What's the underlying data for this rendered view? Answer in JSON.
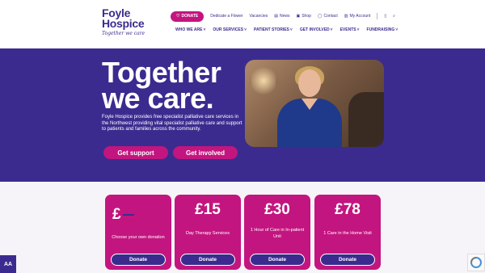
{
  "logo": {
    "line1": "Foyle",
    "line2": "Hospice",
    "tagline": "Together we care"
  },
  "topbar": {
    "donate": "DONATE",
    "links": [
      "Dedicate a Flower",
      "Vacancies",
      "News",
      "Shop",
      "Contact",
      "My Account"
    ]
  },
  "nav": [
    "WHO WE ARE",
    "OUR SERVICES",
    "PATIENT STORIES",
    "GET INVOLVED",
    "EVENTS",
    "FUNDRAISING"
  ],
  "hero": {
    "title": "Together we care.",
    "text": "Foyle Hospice provides free specialist palliative care services in the Northwest providing vital specialist palliative care and support to patients and families across the community.",
    "btn_support": "Get support",
    "btn_involved": "Get involved"
  },
  "cards": [
    {
      "amount": "£",
      "desc": "Choose your own donation",
      "btn": "Donate"
    },
    {
      "amount": "£15",
      "desc": "Day Therapy Services",
      "btn": "Donate"
    },
    {
      "amount": "£30",
      "desc": "1 Hour of Care in In-patient Unit",
      "btn": "Donate"
    },
    {
      "amount": "£78",
      "desc": "1 Care in the Home Visit",
      "btn": "Donate"
    }
  ],
  "accessibility": "AA",
  "colors": {
    "purple": "#3b2b8f",
    "magenta": "#c3157f"
  }
}
